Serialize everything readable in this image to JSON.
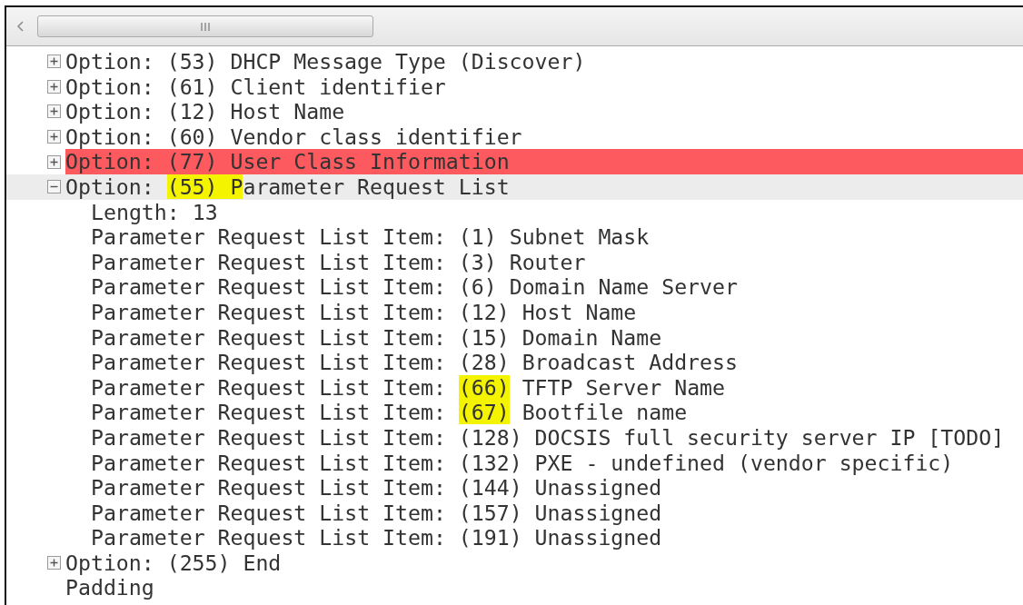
{
  "tree": [
    {
      "kind": "option",
      "expanded": false,
      "selected": false,
      "error": false,
      "text": "Option: (53) DHCP Message Type (Discover)"
    },
    {
      "kind": "option",
      "expanded": false,
      "selected": false,
      "error": false,
      "text": "Option: (61) Client identifier"
    },
    {
      "kind": "option",
      "expanded": false,
      "selected": false,
      "error": false,
      "text": "Option: (12) Host Name"
    },
    {
      "kind": "option",
      "expanded": false,
      "selected": false,
      "error": false,
      "text": "Option: (60) Vendor class identifier"
    },
    {
      "kind": "option",
      "expanded": false,
      "selected": false,
      "error": true,
      "text": "Option: (77) User Class Information"
    },
    {
      "kind": "option",
      "expanded": true,
      "selected": true,
      "error": false,
      "parts": [
        {
          "text": "Option: ",
          "highlighted": false
        },
        {
          "text": "(55) P",
          "highlighted": true
        },
        {
          "text": "arameter Request List",
          "highlighted": false
        }
      ],
      "children": [
        {
          "kind": "field",
          "selected": false,
          "error": false,
          "text": "Length: 13"
        },
        {
          "kind": "field",
          "selected": false,
          "error": false,
          "text": "Parameter Request List Item: (1) Subnet Mask"
        },
        {
          "kind": "field",
          "selected": false,
          "error": false,
          "text": "Parameter Request List Item: (3) Router"
        },
        {
          "kind": "field",
          "selected": false,
          "error": false,
          "text": "Parameter Request List Item: (6) Domain Name Server"
        },
        {
          "kind": "field",
          "selected": false,
          "error": false,
          "text": "Parameter Request List Item: (12) Host Name"
        },
        {
          "kind": "field",
          "selected": false,
          "error": false,
          "text": "Parameter Request List Item: (15) Domain Name"
        },
        {
          "kind": "field",
          "selected": false,
          "error": false,
          "text": "Parameter Request List Item: (28) Broadcast Address"
        },
        {
          "kind": "field",
          "selected": false,
          "error": false,
          "parts": [
            {
              "text": "Parameter Request List Item: ",
              "highlighted": false
            },
            {
              "text": "(66)",
              "highlighted": true
            },
            {
              "text": " TFTP Server Name",
              "highlighted": false
            }
          ]
        },
        {
          "kind": "field",
          "selected": false,
          "error": false,
          "parts": [
            {
              "text": "Parameter Request List Item: ",
              "highlighted": false
            },
            {
              "text": "(67)",
              "highlighted": true
            },
            {
              "text": " Bootfile name",
              "highlighted": false
            }
          ]
        },
        {
          "kind": "field",
          "selected": false,
          "error": false,
          "text": "Parameter Request List Item: (128) DOCSIS full security server IP [TODO]"
        },
        {
          "kind": "field",
          "selected": false,
          "error": false,
          "text": "Parameter Request List Item: (132) PXE - undefined (vendor specific)"
        },
        {
          "kind": "field",
          "selected": false,
          "error": false,
          "text": "Parameter Request List Item: (144) Unassigned"
        },
        {
          "kind": "field",
          "selected": false,
          "error": false,
          "text": "Parameter Request List Item: (157) Unassigned"
        },
        {
          "kind": "field",
          "selected": false,
          "error": false,
          "text": "Parameter Request List Item: (191) Unassigned"
        }
      ]
    },
    {
      "kind": "option",
      "expanded": false,
      "selected": false,
      "error": false,
      "text": "Option: (255) End"
    },
    {
      "kind": "field",
      "selected": false,
      "error": false,
      "text": "Padding"
    }
  ]
}
